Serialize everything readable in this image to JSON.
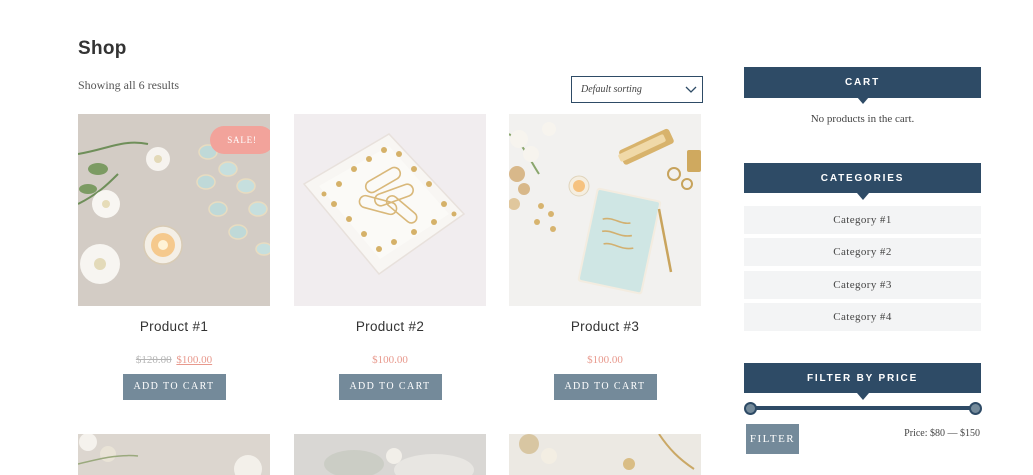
{
  "page_title": "Shop",
  "result_count": "Showing all 6 results",
  "sorting": {
    "selected": "Default sorting",
    "icon": "chevron-down-icon"
  },
  "products": [
    {
      "name": "Product #1",
      "old_price": "$120.00",
      "price": "$100.00",
      "on_sale": true,
      "sale_badge": "SALE!",
      "button": "ADD TO CART"
    },
    {
      "name": "Product #2",
      "price": "$100.00",
      "on_sale": false,
      "button": "ADD TO CART"
    },
    {
      "name": "Product #3",
      "price": "$100.00",
      "on_sale": false,
      "button": "ADD TO CART"
    }
  ],
  "sidebar": {
    "cart": {
      "title": "CART",
      "empty_text": "No products in the cart."
    },
    "categories": {
      "title": "CATEGORIES",
      "items": [
        "Category #1",
        "Category #2",
        "Category #3",
        "Category #4"
      ]
    },
    "filter": {
      "title": "FILTER BY PRICE",
      "button": "FILTER",
      "price_label": "Price: $80 — $150"
    }
  },
  "colors": {
    "navy": "#2e4b66",
    "slate": "#748a9a",
    "sale_pink": "#f2a39b",
    "price_pink": "#e8998d",
    "light_gray": "#f3f4f5"
  }
}
